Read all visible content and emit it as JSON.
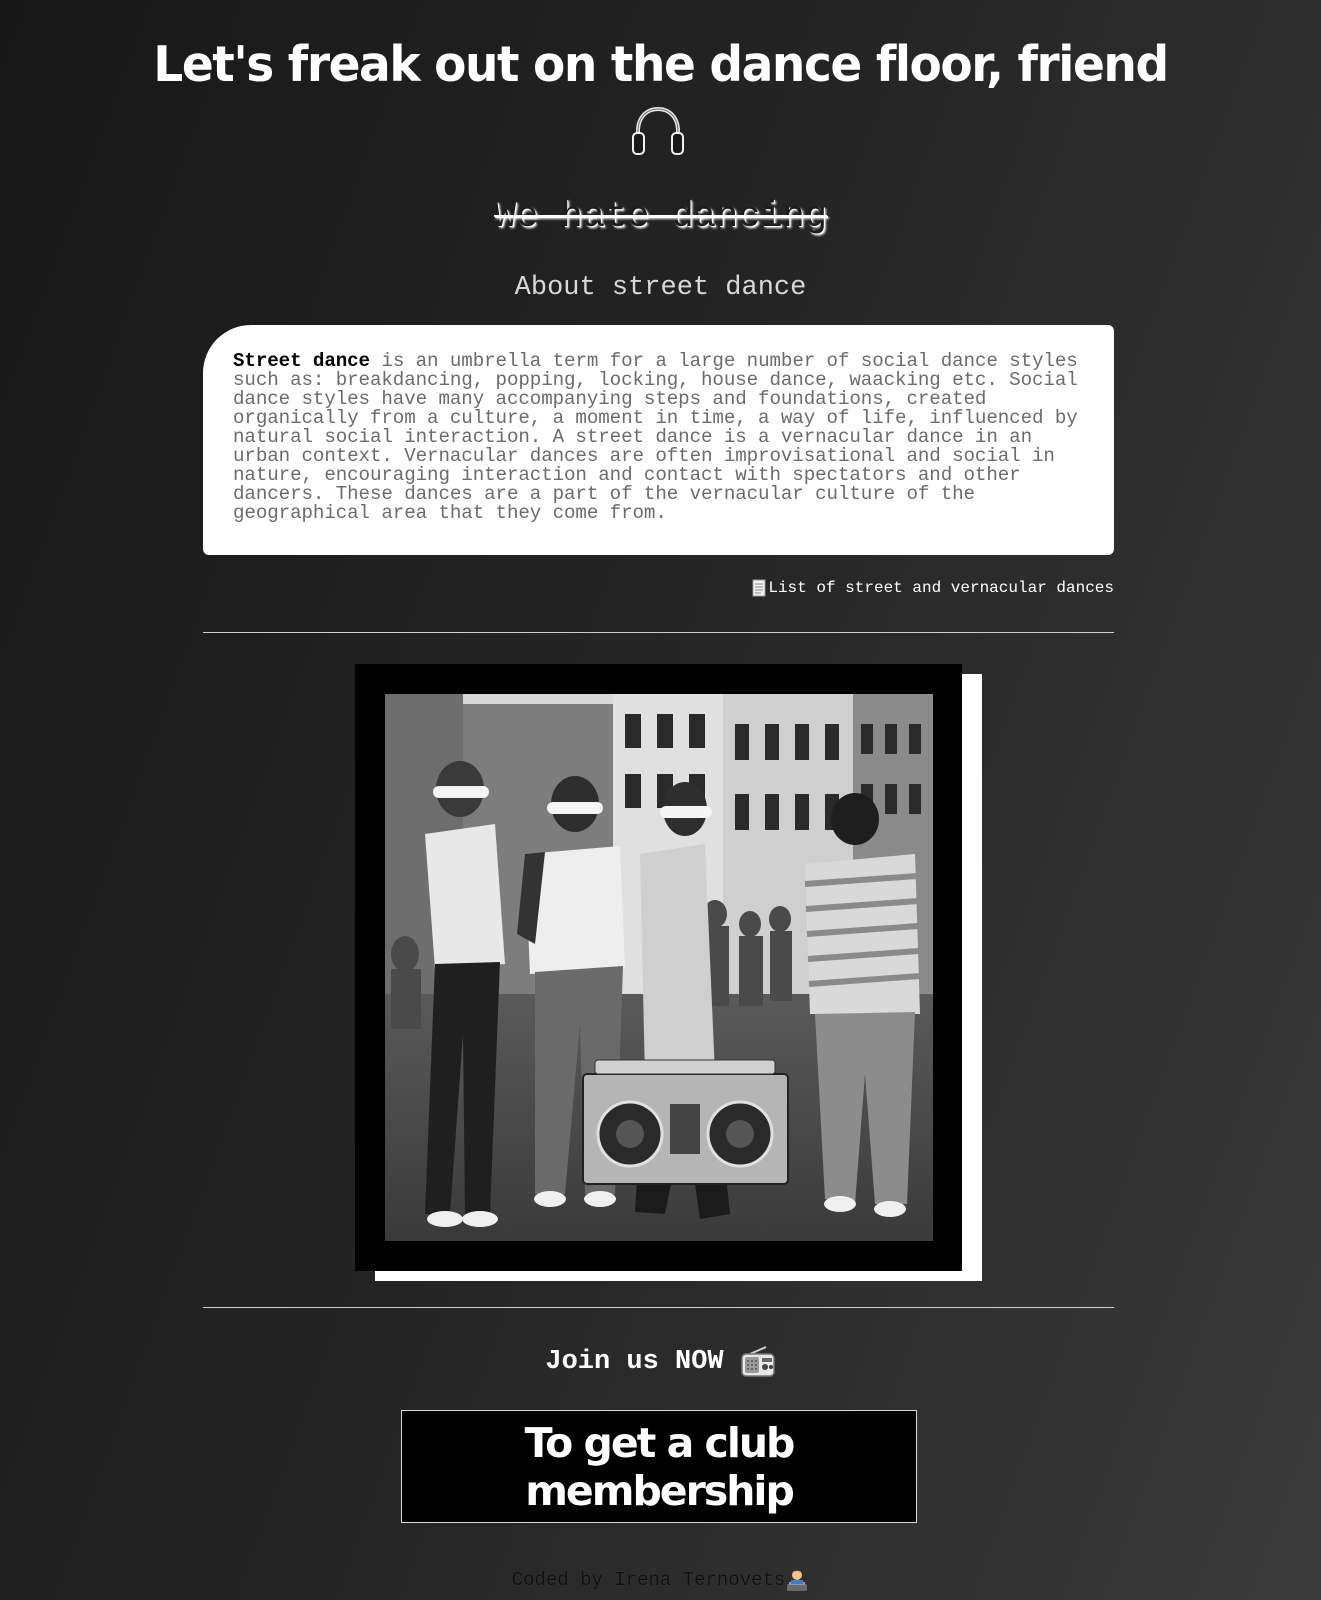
{
  "header": {
    "title": "Let's freak out on the dance floor, friend",
    "icon": "headphones-icon",
    "struck_tagline": "We hate dancing"
  },
  "about": {
    "heading": "About street dance",
    "term": "Street dance",
    "body": " is an umbrella term for a large number of social dance styles such as: breakdancing, popping, locking, house dance, waacking etc. Social dance styles have many accompanying steps and foundations, created organically from a culture, a moment in time, a way of life, influenced by natural social interaction. A street dance is a vernacular dance in an urban context. Vernacular dances are often improvisational and social in nature, encouraging interaction and contact with spectators and other dancers. These dances are a part of the vernacular culture of the geographical area that they come from.",
    "list_link": "List of street and vernacular dances",
    "list_link_icon": "page-icon"
  },
  "photo": {
    "icon": "street-dancers-photo"
  },
  "join": {
    "heading": "Join us NOW",
    "icon": "radio-icon",
    "button_label": "To get a club membership"
  },
  "footer": {
    "credit": "Coded by Irena Ternovets",
    "icon": "technologist-icon"
  },
  "colors": {
    "background_dark": "#171717",
    "background_light": "#3b3a3b",
    "card": "#ffffff",
    "card_text": "#6c6c6c",
    "button_bg": "#000000",
    "accent_white": "#ffffff"
  }
}
